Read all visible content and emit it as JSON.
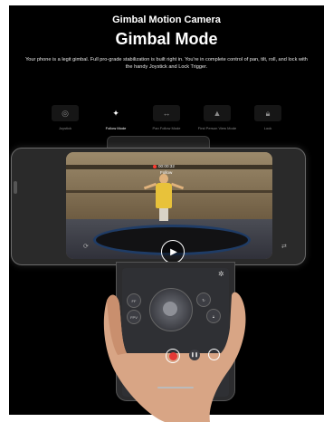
{
  "header": {
    "kicker": "Gimbal Motion Camera",
    "title": "Gimbal Mode",
    "description": "Your phone is a legit gimbal. Full pro-grade stabilization is built right in. You're in complete control of pan, tilt, roll, and lock with the handy Joystick and Lock Trigger."
  },
  "modes": [
    {
      "label": "Joystick",
      "icon": "joystick-icon",
      "active": false
    },
    {
      "label": "Follow Mode",
      "icon": "person-icon",
      "active": true
    },
    {
      "label": "Pan Follow Mode",
      "icon": "pan-person-icon",
      "active": false
    },
    {
      "label": "First Person View Mode",
      "icon": "fpv-icon",
      "active": false
    },
    {
      "label": "Lock",
      "icon": "lock-icon",
      "active": false
    }
  ],
  "video": {
    "timer": "00:00:32",
    "mode_label": "Follow",
    "recording_color": "#ff3b30"
  },
  "controls": {
    "fpv_label": "FPV",
    "ff_label": "FF",
    "record_color": "#e53935"
  }
}
